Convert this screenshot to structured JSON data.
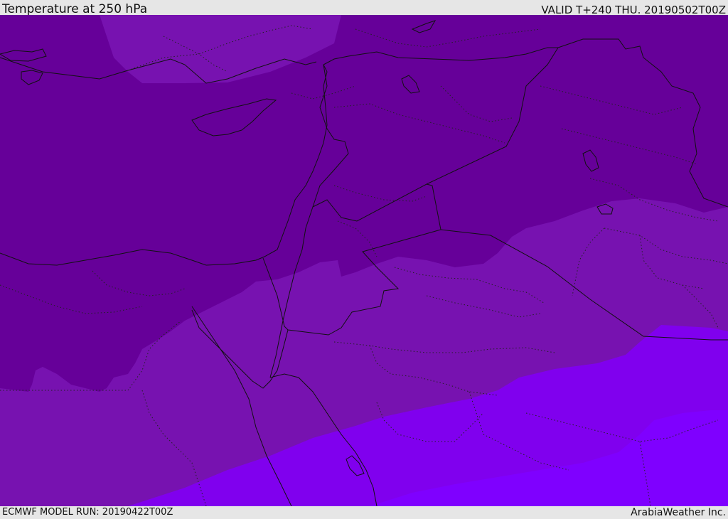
{
  "header": {
    "title": "Temperature at 250 hPa",
    "valid": "VALID T+240 THU. 20190502T00Z"
  },
  "footer": {
    "model_run": "ECMWF MODEL RUN: 20190422T00Z",
    "credit": "ArabiaWeather Inc."
  },
  "colors": {
    "band_coldest": "#660099",
    "band_cold": "#7712b0",
    "band_mid": "#8000ee",
    "band_warm": "#7a00ff",
    "band_warmest": "#7f00ff",
    "boundary_lines": "#111111"
  }
}
